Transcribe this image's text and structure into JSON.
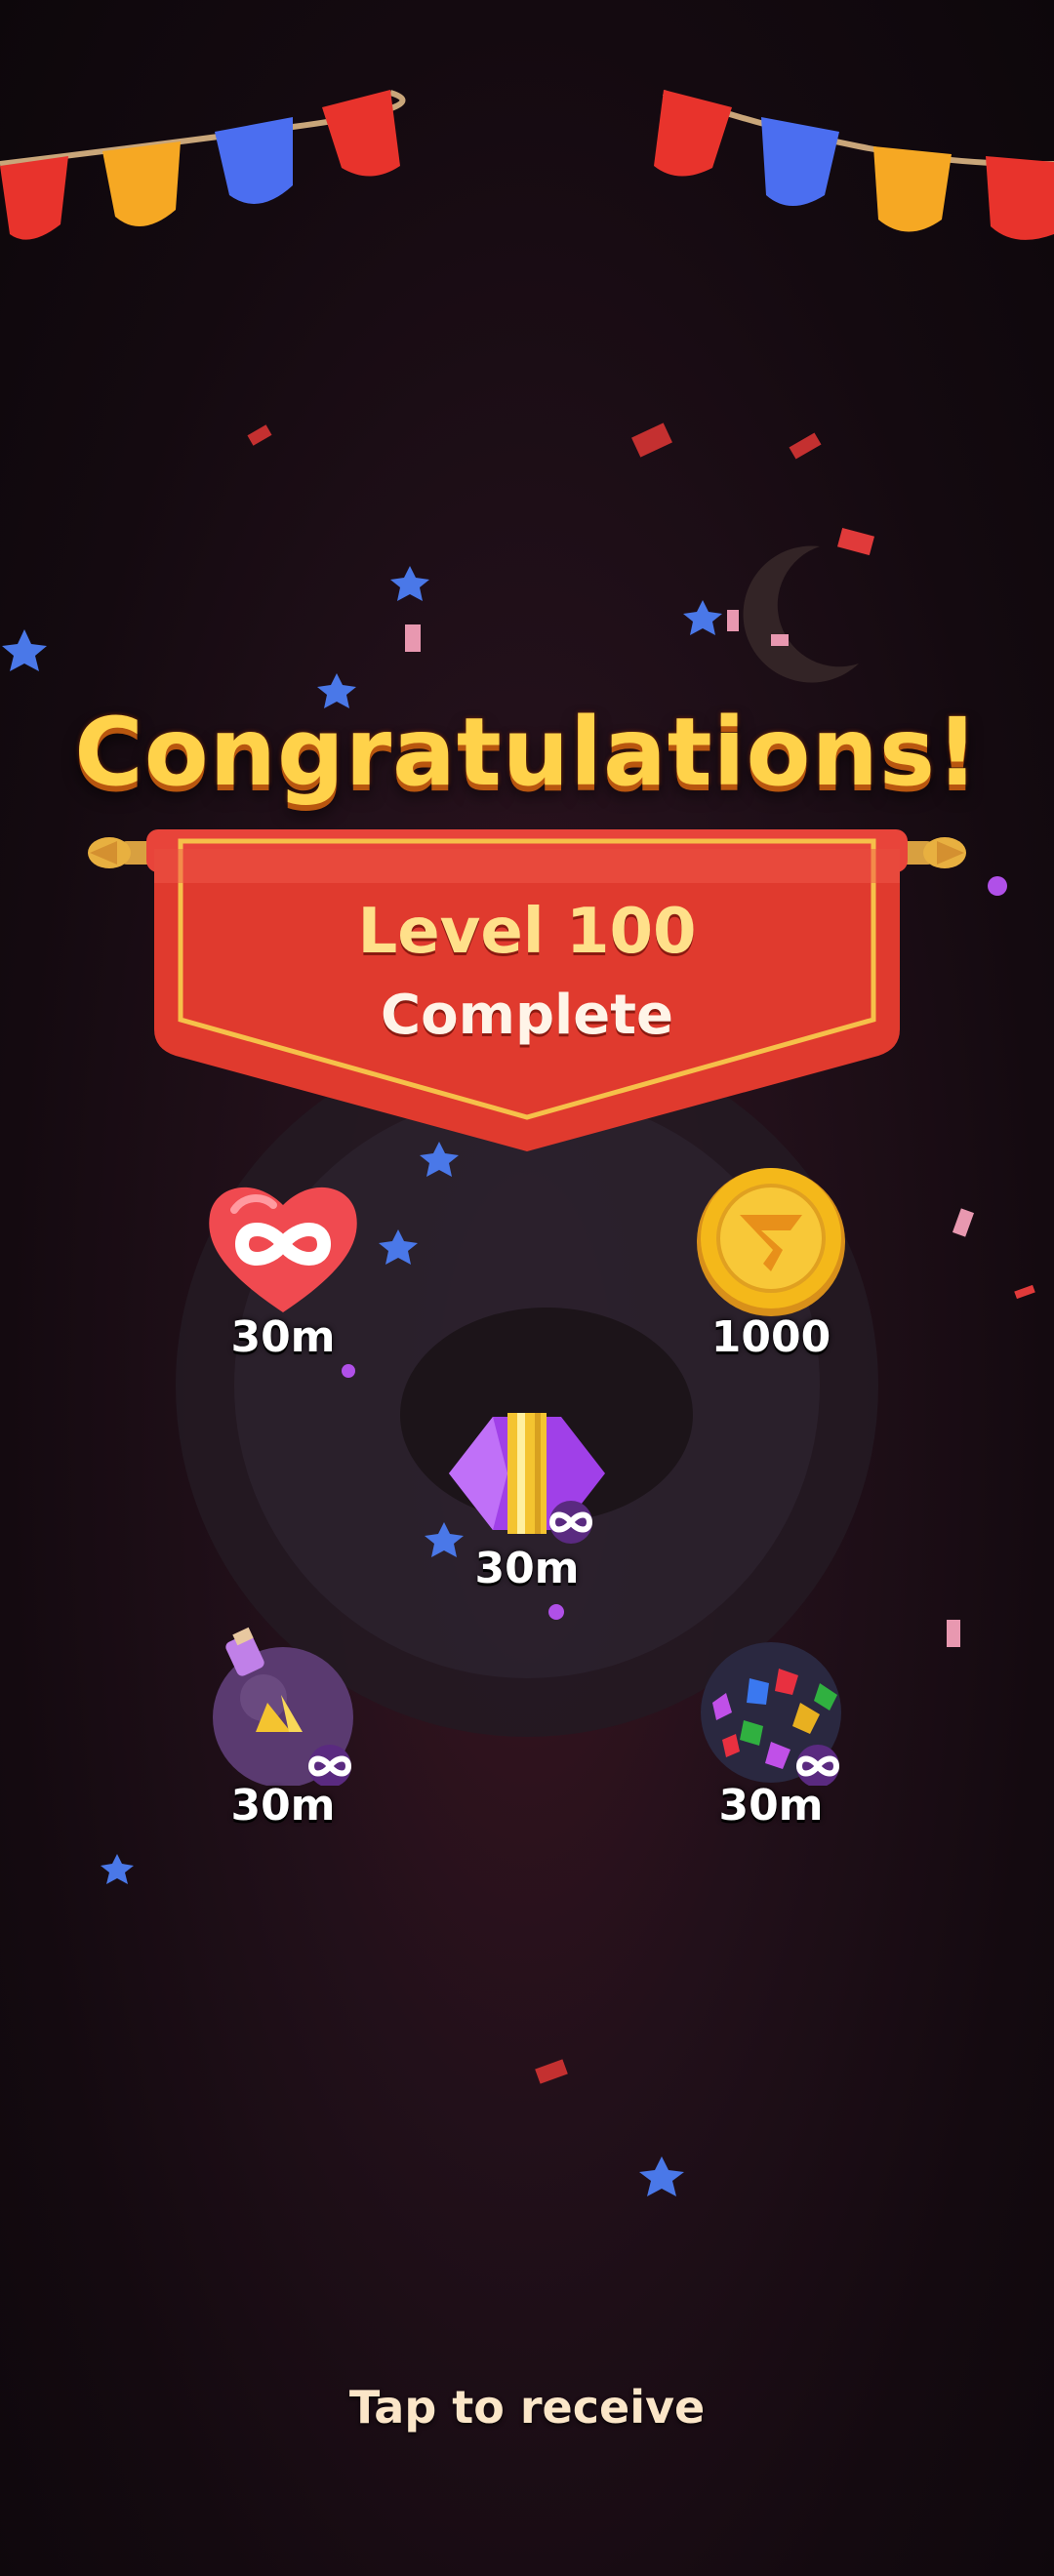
{
  "title": "Congratulations!",
  "banner": {
    "level": "Level 100",
    "status": "Complete"
  },
  "rewards": [
    {
      "name": "infinite-heart",
      "label": "30m"
    },
    {
      "name": "coin",
      "label": "1000"
    },
    {
      "name": "rocket-booster",
      "label": "30m"
    },
    {
      "name": "bomb-booster",
      "label": "30m"
    },
    {
      "name": "gem-ball-booster",
      "label": "30m"
    }
  ],
  "tap_text": "Tap to receive",
  "colors": {
    "title_gold": "#ffd24a",
    "banner_red": "#e03a2e",
    "heart_red": "#f04a50",
    "coin_gold": "#f4b81a",
    "rocket_purple": "#a040e8",
    "bomb_purple": "#5a3a70"
  }
}
